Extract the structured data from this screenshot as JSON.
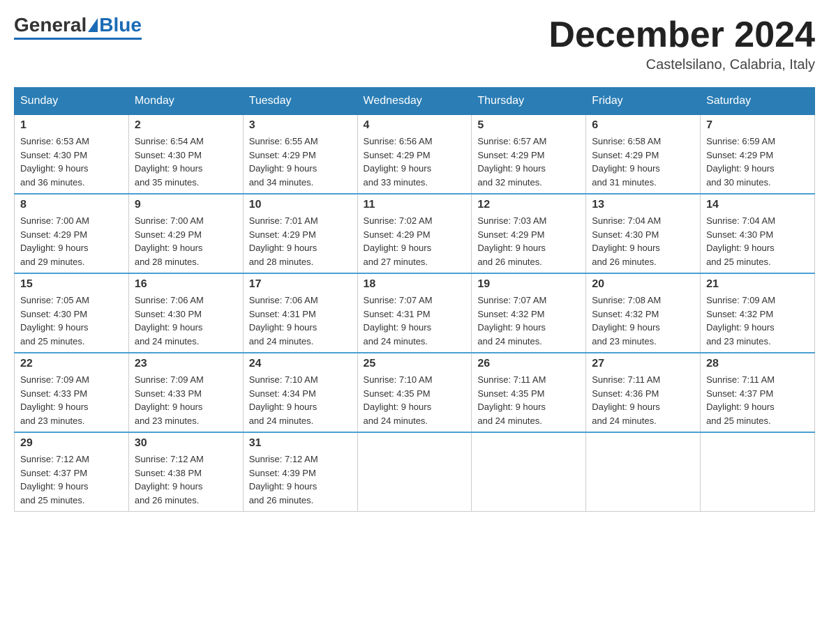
{
  "header": {
    "logo": {
      "general": "General",
      "blue": "Blue"
    },
    "title": "December 2024",
    "location": "Castelsilano, Calabria, Italy"
  },
  "calendar": {
    "weekdays": [
      "Sunday",
      "Monday",
      "Tuesday",
      "Wednesday",
      "Thursday",
      "Friday",
      "Saturday"
    ],
    "weeks": [
      [
        {
          "day": "1",
          "sunrise": "6:53 AM",
          "sunset": "4:30 PM",
          "daylight": "9 hours and 36 minutes."
        },
        {
          "day": "2",
          "sunrise": "6:54 AM",
          "sunset": "4:30 PM",
          "daylight": "9 hours and 35 minutes."
        },
        {
          "day": "3",
          "sunrise": "6:55 AM",
          "sunset": "4:29 PM",
          "daylight": "9 hours and 34 minutes."
        },
        {
          "day": "4",
          "sunrise": "6:56 AM",
          "sunset": "4:29 PM",
          "daylight": "9 hours and 33 minutes."
        },
        {
          "day": "5",
          "sunrise": "6:57 AM",
          "sunset": "4:29 PM",
          "daylight": "9 hours and 32 minutes."
        },
        {
          "day": "6",
          "sunrise": "6:58 AM",
          "sunset": "4:29 PM",
          "daylight": "9 hours and 31 minutes."
        },
        {
          "day": "7",
          "sunrise": "6:59 AM",
          "sunset": "4:29 PM",
          "daylight": "9 hours and 30 minutes."
        }
      ],
      [
        {
          "day": "8",
          "sunrise": "7:00 AM",
          "sunset": "4:29 PM",
          "daylight": "9 hours and 29 minutes."
        },
        {
          "day": "9",
          "sunrise": "7:00 AM",
          "sunset": "4:29 PM",
          "daylight": "9 hours and 28 minutes."
        },
        {
          "day": "10",
          "sunrise": "7:01 AM",
          "sunset": "4:29 PM",
          "daylight": "9 hours and 28 minutes."
        },
        {
          "day": "11",
          "sunrise": "7:02 AM",
          "sunset": "4:29 PM",
          "daylight": "9 hours and 27 minutes."
        },
        {
          "day": "12",
          "sunrise": "7:03 AM",
          "sunset": "4:29 PM",
          "daylight": "9 hours and 26 minutes."
        },
        {
          "day": "13",
          "sunrise": "7:04 AM",
          "sunset": "4:30 PM",
          "daylight": "9 hours and 26 minutes."
        },
        {
          "day": "14",
          "sunrise": "7:04 AM",
          "sunset": "4:30 PM",
          "daylight": "9 hours and 25 minutes."
        }
      ],
      [
        {
          "day": "15",
          "sunrise": "7:05 AM",
          "sunset": "4:30 PM",
          "daylight": "9 hours and 25 minutes."
        },
        {
          "day": "16",
          "sunrise": "7:06 AM",
          "sunset": "4:30 PM",
          "daylight": "9 hours and 24 minutes."
        },
        {
          "day": "17",
          "sunrise": "7:06 AM",
          "sunset": "4:31 PM",
          "daylight": "9 hours and 24 minutes."
        },
        {
          "day": "18",
          "sunrise": "7:07 AM",
          "sunset": "4:31 PM",
          "daylight": "9 hours and 24 minutes."
        },
        {
          "day": "19",
          "sunrise": "7:07 AM",
          "sunset": "4:32 PM",
          "daylight": "9 hours and 24 minutes."
        },
        {
          "day": "20",
          "sunrise": "7:08 AM",
          "sunset": "4:32 PM",
          "daylight": "9 hours and 23 minutes."
        },
        {
          "day": "21",
          "sunrise": "7:09 AM",
          "sunset": "4:32 PM",
          "daylight": "9 hours and 23 minutes."
        }
      ],
      [
        {
          "day": "22",
          "sunrise": "7:09 AM",
          "sunset": "4:33 PM",
          "daylight": "9 hours and 23 minutes."
        },
        {
          "day": "23",
          "sunrise": "7:09 AM",
          "sunset": "4:33 PM",
          "daylight": "9 hours and 23 minutes."
        },
        {
          "day": "24",
          "sunrise": "7:10 AM",
          "sunset": "4:34 PM",
          "daylight": "9 hours and 24 minutes."
        },
        {
          "day": "25",
          "sunrise": "7:10 AM",
          "sunset": "4:35 PM",
          "daylight": "9 hours and 24 minutes."
        },
        {
          "day": "26",
          "sunrise": "7:11 AM",
          "sunset": "4:35 PM",
          "daylight": "9 hours and 24 minutes."
        },
        {
          "day": "27",
          "sunrise": "7:11 AM",
          "sunset": "4:36 PM",
          "daylight": "9 hours and 24 minutes."
        },
        {
          "day": "28",
          "sunrise": "7:11 AM",
          "sunset": "4:37 PM",
          "daylight": "9 hours and 25 minutes."
        }
      ],
      [
        {
          "day": "29",
          "sunrise": "7:12 AM",
          "sunset": "4:37 PM",
          "daylight": "9 hours and 25 minutes."
        },
        {
          "day": "30",
          "sunrise": "7:12 AM",
          "sunset": "4:38 PM",
          "daylight": "9 hours and 26 minutes."
        },
        {
          "day": "31",
          "sunrise": "7:12 AM",
          "sunset": "4:39 PM",
          "daylight": "9 hours and 26 minutes."
        },
        null,
        null,
        null,
        null
      ]
    ],
    "labels": {
      "sunrise": "Sunrise:",
      "sunset": "Sunset:",
      "daylight": "Daylight:"
    }
  }
}
